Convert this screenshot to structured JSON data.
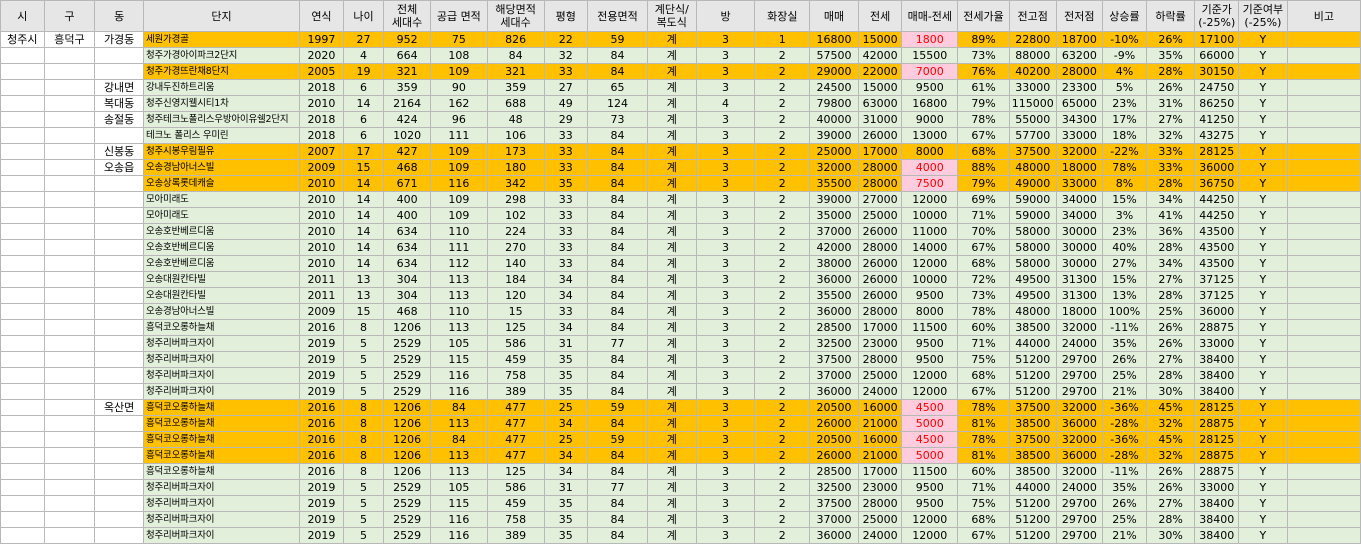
{
  "headers": [
    "시",
    "구",
    "동",
    "단지",
    "연식",
    "나이",
    "전체\n세대수",
    "공급 면적",
    "해당면적\n세대수",
    "평형",
    "전용면적",
    "계단식/\n복도식",
    "방",
    "화장실",
    "매매",
    "전세",
    "매매-전세",
    "전세가율",
    "전고점",
    "전저점",
    "상승률",
    "하락률",
    "기준가\n(-25%)",
    "기준여부\n(-25%)",
    "비고"
  ],
  "colors": {
    "header_bg": "#e7e6e6",
    "green_row": "#e2efda",
    "orange_row": "#ffc000",
    "pink_cell": "#ffccdd",
    "pink_text": "#ff0000"
  },
  "rows": [
    {
      "style": "o",
      "pink": true,
      "si": "청주시",
      "gu": "흥덕구",
      "dong": "가경동",
      "c": [
        "세원가경골",
        "1997",
        "27",
        "952",
        "75",
        "826",
        "22",
        "59",
        "계",
        "3",
        "1",
        "16800",
        "15000",
        "1800",
        "89%",
        "22800",
        "18700",
        "-10%",
        "26%",
        "17100",
        "Y",
        ""
      ]
    },
    {
      "style": "g",
      "pink": false,
      "si": "",
      "gu": "",
      "dong": "",
      "c": [
        "청주가경아이파크2단지",
        "2020",
        "4",
        "664",
        "108",
        "84",
        "32",
        "84",
        "계",
        "3",
        "2",
        "57500",
        "42000",
        "15500",
        "73%",
        "88000",
        "63200",
        "-9%",
        "35%",
        "66000",
        "Y",
        ""
      ]
    },
    {
      "style": "o",
      "pink": true,
      "si": "",
      "gu": "",
      "dong": "",
      "c": [
        "청주가경뜨란채8단지",
        "2005",
        "19",
        "321",
        "109",
        "321",
        "33",
        "84",
        "계",
        "3",
        "2",
        "29000",
        "22000",
        "7000",
        "76%",
        "40200",
        "28000",
        "4%",
        "28%",
        "30150",
        "Y",
        ""
      ]
    },
    {
      "style": "g",
      "pink": false,
      "si": "",
      "gu": "",
      "dong": "강내면",
      "c": [
        "강내두진하트리움",
        "2018",
        "6",
        "359",
        "90",
        "359",
        "27",
        "65",
        "계",
        "3",
        "2",
        "24500",
        "15000",
        "9500",
        "61%",
        "33000",
        "23300",
        "5%",
        "26%",
        "24750",
        "Y",
        ""
      ]
    },
    {
      "style": "g",
      "pink": false,
      "si": "",
      "gu": "",
      "dong": "복대동",
      "c": [
        "청주신영지웰시티1차",
        "2010",
        "14",
        "2164",
        "162",
        "688",
        "49",
        "124",
        "계",
        "4",
        "2",
        "79800",
        "63000",
        "16800",
        "79%",
        "115000",
        "65000",
        "23%",
        "31%",
        "86250",
        "Y",
        ""
      ]
    },
    {
      "style": "g",
      "pink": false,
      "si": "",
      "gu": "",
      "dong": "송절동",
      "c": [
        "청주테크노폴리스우방아이유쉘2단지",
        "2018",
        "6",
        "424",
        "96",
        "48",
        "29",
        "73",
        "계",
        "3",
        "2",
        "40000",
        "31000",
        "9000",
        "78%",
        "55000",
        "34300",
        "17%",
        "27%",
        "41250",
        "Y",
        ""
      ]
    },
    {
      "style": "g",
      "pink": false,
      "si": "",
      "gu": "",
      "dong": "",
      "c": [
        "테크노 폴리스 우미린",
        "2018",
        "6",
        "1020",
        "111",
        "106",
        "33",
        "84",
        "계",
        "3",
        "2",
        "39000",
        "26000",
        "13000",
        "67%",
        "57700",
        "33000",
        "18%",
        "32%",
        "43275",
        "Y",
        ""
      ]
    },
    {
      "style": "o",
      "pink": false,
      "si": "",
      "gu": "",
      "dong": "신봉동",
      "c": [
        "청주시봉우림필유",
        "2007",
        "17",
        "427",
        "109",
        "173",
        "33",
        "84",
        "계",
        "3",
        "2",
        "25000",
        "17000",
        "8000",
        "68%",
        "37500",
        "32000",
        "-22%",
        "33%",
        "28125",
        "Y",
        ""
      ]
    },
    {
      "style": "o",
      "pink": true,
      "si": "",
      "gu": "",
      "dong": "오송읍",
      "c": [
        "오송경남아너스빌",
        "2009",
        "15",
        "468",
        "109",
        "180",
        "33",
        "84",
        "계",
        "3",
        "2",
        "32000",
        "28000",
        "4000",
        "88%",
        "48000",
        "18000",
        "78%",
        "33%",
        "36000",
        "Y",
        ""
      ]
    },
    {
      "style": "o",
      "pink": true,
      "si": "",
      "gu": "",
      "dong": "",
      "c": [
        "오송상록롯데캐슬",
        "2010",
        "14",
        "671",
        "116",
        "342",
        "35",
        "84",
        "계",
        "3",
        "2",
        "35500",
        "28000",
        "7500",
        "79%",
        "49000",
        "33000",
        "8%",
        "28%",
        "36750",
        "Y",
        ""
      ]
    },
    {
      "style": "g",
      "pink": false,
      "si": "",
      "gu": "",
      "dong": "",
      "c": [
        "모아미래도",
        "2010",
        "14",
        "400",
        "109",
        "298",
        "33",
        "84",
        "계",
        "3",
        "2",
        "39000",
        "27000",
        "12000",
        "69%",
        "59000",
        "34000",
        "15%",
        "34%",
        "44250",
        "Y",
        ""
      ]
    },
    {
      "style": "g",
      "pink": false,
      "si": "",
      "gu": "",
      "dong": "",
      "c": [
        "모아미래도",
        "2010",
        "14",
        "400",
        "109",
        "102",
        "33",
        "84",
        "계",
        "3",
        "2",
        "35000",
        "25000",
        "10000",
        "71%",
        "59000",
        "34000",
        "3%",
        "41%",
        "44250",
        "Y",
        ""
      ]
    },
    {
      "style": "g",
      "pink": false,
      "si": "",
      "gu": "",
      "dong": "",
      "c": [
        "오송호반베르디움",
        "2010",
        "14",
        "634",
        "110",
        "224",
        "33",
        "84",
        "계",
        "3",
        "2",
        "37000",
        "26000",
        "11000",
        "70%",
        "58000",
        "30000",
        "23%",
        "36%",
        "43500",
        "Y",
        ""
      ]
    },
    {
      "style": "g",
      "pink": false,
      "si": "",
      "gu": "",
      "dong": "",
      "c": [
        "오송호반베르디움",
        "2010",
        "14",
        "634",
        "111",
        "270",
        "33",
        "84",
        "계",
        "3",
        "2",
        "42000",
        "28000",
        "14000",
        "67%",
        "58000",
        "30000",
        "40%",
        "28%",
        "43500",
        "Y",
        ""
      ]
    },
    {
      "style": "g",
      "pink": false,
      "si": "",
      "gu": "",
      "dong": "",
      "c": [
        "오송호반베르디움",
        "2010",
        "14",
        "634",
        "112",
        "140",
        "33",
        "84",
        "계",
        "3",
        "2",
        "38000",
        "26000",
        "12000",
        "68%",
        "58000",
        "30000",
        "27%",
        "34%",
        "43500",
        "Y",
        ""
      ]
    },
    {
      "style": "g",
      "pink": false,
      "si": "",
      "gu": "",
      "dong": "",
      "c": [
        "오송대원칸타빌",
        "2011",
        "13",
        "304",
        "113",
        "184",
        "34",
        "84",
        "계",
        "3",
        "2",
        "36000",
        "26000",
        "10000",
        "72%",
        "49500",
        "31300",
        "15%",
        "27%",
        "37125",
        "Y",
        ""
      ]
    },
    {
      "style": "g",
      "pink": false,
      "si": "",
      "gu": "",
      "dong": "",
      "c": [
        "오송대원칸타빌",
        "2011",
        "13",
        "304",
        "113",
        "120",
        "34",
        "84",
        "계",
        "3",
        "2",
        "35500",
        "26000",
        "9500",
        "73%",
        "49500",
        "31300",
        "13%",
        "28%",
        "37125",
        "Y",
        ""
      ]
    },
    {
      "style": "g",
      "pink": false,
      "si": "",
      "gu": "",
      "dong": "",
      "c": [
        "오송경남아너스빌",
        "2009",
        "15",
        "468",
        "110",
        "15",
        "33",
        "84",
        "계",
        "3",
        "2",
        "36000",
        "28000",
        "8000",
        "78%",
        "48000",
        "18000",
        "100%",
        "25%",
        "36000",
        "Y",
        ""
      ]
    },
    {
      "style": "g",
      "pink": false,
      "si": "",
      "gu": "",
      "dong": "",
      "c": [
        "흥덕코오롱하늘채",
        "2016",
        "8",
        "1206",
        "113",
        "125",
        "34",
        "84",
        "계",
        "3",
        "2",
        "28500",
        "17000",
        "11500",
        "60%",
        "38500",
        "32000",
        "-11%",
        "26%",
        "28875",
        "Y",
        ""
      ]
    },
    {
      "style": "g",
      "pink": false,
      "si": "",
      "gu": "",
      "dong": "",
      "c": [
        "청주리버파크자이",
        "2019",
        "5",
        "2529",
        "105",
        "586",
        "31",
        "77",
        "계",
        "3",
        "2",
        "32500",
        "23000",
        "9500",
        "71%",
        "44000",
        "24000",
        "35%",
        "26%",
        "33000",
        "Y",
        ""
      ]
    },
    {
      "style": "g",
      "pink": false,
      "si": "",
      "gu": "",
      "dong": "",
      "c": [
        "청주리버파크자이",
        "2019",
        "5",
        "2529",
        "115",
        "459",
        "35",
        "84",
        "계",
        "3",
        "2",
        "37500",
        "28000",
        "9500",
        "75%",
        "51200",
        "29700",
        "26%",
        "27%",
        "38400",
        "Y",
        ""
      ]
    },
    {
      "style": "g",
      "pink": false,
      "si": "",
      "gu": "",
      "dong": "",
      "c": [
        "청주리버파크자이",
        "2019",
        "5",
        "2529",
        "116",
        "758",
        "35",
        "84",
        "계",
        "3",
        "2",
        "37000",
        "25000",
        "12000",
        "68%",
        "51200",
        "29700",
        "25%",
        "28%",
        "38400",
        "Y",
        ""
      ]
    },
    {
      "style": "g",
      "pink": false,
      "si": "",
      "gu": "",
      "dong": "",
      "c": [
        "청주리버파크자이",
        "2019",
        "5",
        "2529",
        "116",
        "389",
        "35",
        "84",
        "계",
        "3",
        "2",
        "36000",
        "24000",
        "12000",
        "67%",
        "51200",
        "29700",
        "21%",
        "30%",
        "38400",
        "Y",
        ""
      ]
    },
    {
      "style": "o",
      "pink": true,
      "si": "",
      "gu": "",
      "dong": "옥산면",
      "c": [
        "흥덕코오롱하늘채",
        "2016",
        "8",
        "1206",
        "84",
        "477",
        "25",
        "59",
        "계",
        "3",
        "2",
        "20500",
        "16000",
        "4500",
        "78%",
        "37500",
        "32000",
        "-36%",
        "45%",
        "28125",
        "Y",
        ""
      ]
    },
    {
      "style": "o",
      "pink": true,
      "si": "",
      "gu": "",
      "dong": "",
      "c": [
        "흥덕코오롱하늘채",
        "2016",
        "8",
        "1206",
        "113",
        "477",
        "34",
        "84",
        "계",
        "3",
        "2",
        "26000",
        "21000",
        "5000",
        "81%",
        "38500",
        "36000",
        "-28%",
        "32%",
        "28875",
        "Y",
        ""
      ]
    },
    {
      "style": "o",
      "pink": true,
      "si": "",
      "gu": "",
      "dong": "",
      "c": [
        "흥덕코오롱하늘채",
        "2016",
        "8",
        "1206",
        "84",
        "477",
        "25",
        "59",
        "계",
        "3",
        "2",
        "20500",
        "16000",
        "4500",
        "78%",
        "37500",
        "32000",
        "-36%",
        "45%",
        "28125",
        "Y",
        ""
      ]
    },
    {
      "style": "o",
      "pink": true,
      "si": "",
      "gu": "",
      "dong": "",
      "c": [
        "흥덕코오롱하늘채",
        "2016",
        "8",
        "1206",
        "113",
        "477",
        "34",
        "84",
        "계",
        "3",
        "2",
        "26000",
        "21000",
        "5000",
        "81%",
        "38500",
        "36000",
        "-28%",
        "32%",
        "28875",
        "Y",
        ""
      ]
    },
    {
      "style": "g",
      "pink": false,
      "si": "",
      "gu": "",
      "dong": "",
      "c": [
        "흥덕코오롱하늘채",
        "2016",
        "8",
        "1206",
        "113",
        "125",
        "34",
        "84",
        "계",
        "3",
        "2",
        "28500",
        "17000",
        "11500",
        "60%",
        "38500",
        "32000",
        "-11%",
        "26%",
        "28875",
        "Y",
        ""
      ]
    },
    {
      "style": "g",
      "pink": false,
      "si": "",
      "gu": "",
      "dong": "",
      "c": [
        "청주리버파크자이",
        "2019",
        "5",
        "2529",
        "105",
        "586",
        "31",
        "77",
        "계",
        "3",
        "2",
        "32500",
        "23000",
        "9500",
        "71%",
        "44000",
        "24000",
        "35%",
        "26%",
        "33000",
        "Y",
        ""
      ]
    },
    {
      "style": "g",
      "pink": false,
      "si": "",
      "gu": "",
      "dong": "",
      "c": [
        "청주리버파크자이",
        "2019",
        "5",
        "2529",
        "115",
        "459",
        "35",
        "84",
        "계",
        "3",
        "2",
        "37500",
        "28000",
        "9500",
        "75%",
        "51200",
        "29700",
        "26%",
        "27%",
        "38400",
        "Y",
        ""
      ]
    },
    {
      "style": "g",
      "pink": false,
      "si": "",
      "gu": "",
      "dong": "",
      "c": [
        "청주리버파크자이",
        "2019",
        "5",
        "2529",
        "116",
        "758",
        "35",
        "84",
        "계",
        "3",
        "2",
        "37000",
        "25000",
        "12000",
        "68%",
        "51200",
        "29700",
        "25%",
        "28%",
        "38400",
        "Y",
        ""
      ]
    },
    {
      "style": "g",
      "pink": false,
      "si": "",
      "gu": "",
      "dong": "",
      "c": [
        "청주리버파크자이",
        "2019",
        "5",
        "2529",
        "116",
        "389",
        "35",
        "84",
        "계",
        "3",
        "2",
        "36000",
        "24000",
        "12000",
        "67%",
        "51200",
        "29700",
        "21%",
        "30%",
        "38400",
        "Y",
        ""
      ]
    }
  ]
}
